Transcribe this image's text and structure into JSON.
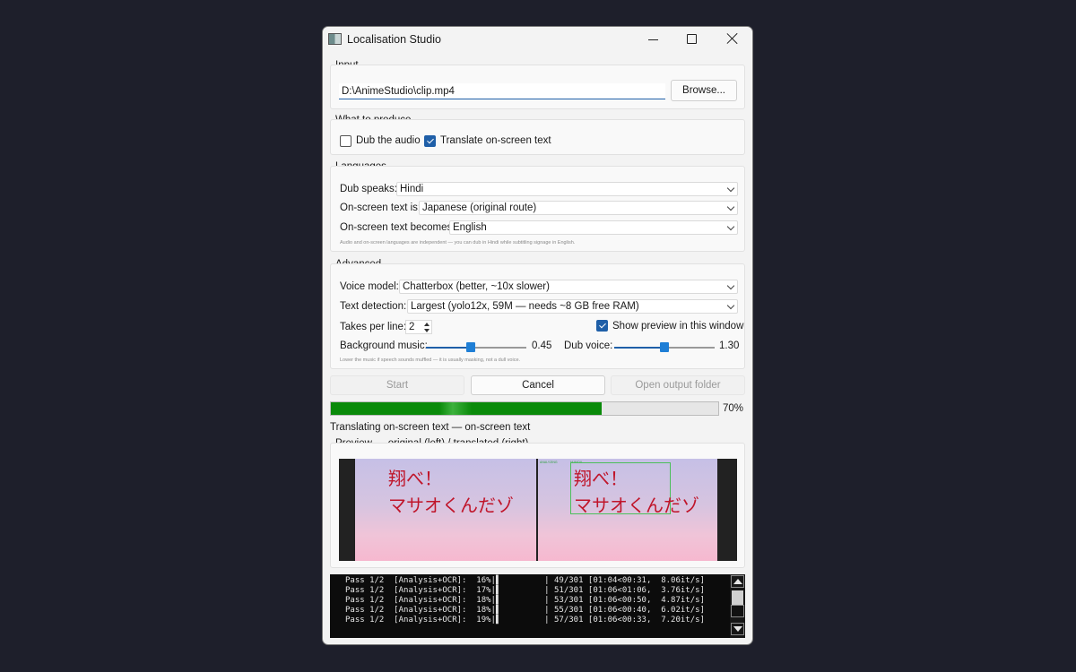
{
  "window": {
    "title": "Localisation Studio"
  },
  "input": {
    "group_title": "Input",
    "path_value": "D:\\AnimeStudio\\clip.mp4",
    "browse_label": "Browse..."
  },
  "produce": {
    "group_title": "What to produce",
    "dub_label": "Dub the audio",
    "dub_checked": false,
    "translate_label": "Translate on-screen text",
    "translate_checked": true
  },
  "languages": {
    "group_title": "Languages",
    "dub_speaks_label": "Dub speaks:",
    "dub_speaks_value": "Hindi",
    "onscreen_is_label": "On-screen text is:",
    "onscreen_is_value": "Japanese (original route)",
    "onscreen_becomes_label": "On-screen text becomes:",
    "onscreen_becomes_value": "English",
    "hint": "Audio and on-screen languages are independent — you can dub in Hindi while subtitling signage in English."
  },
  "advanced": {
    "group_title": "Advanced",
    "voice_model_label": "Voice model:",
    "voice_model_value": "Chatterbox (better, ~10x slower)",
    "text_detection_label": "Text detection:",
    "text_detection_value": "Largest (yolo12x, 59M — needs ~8 GB free RAM)",
    "takes_label": "Takes per line:",
    "takes_value": "2",
    "show_preview_label": "Show preview in this window",
    "show_preview_checked": true,
    "bg_music_label": "Background music:",
    "bg_music_value": "0.45",
    "bg_music_fraction": 0.45,
    "dub_voice_label": "Dub voice:",
    "dub_voice_value": "1.30",
    "dub_voice_fraction": 0.5,
    "hint": "Lower the music if speech sounds muffled — it is usually masking, not a dull voice."
  },
  "actions": {
    "start_label": "Start",
    "cancel_label": "Cancel",
    "open_output_label": "Open output folder"
  },
  "progress": {
    "percent": 70,
    "percent_label": "70%",
    "status": "Translating on-screen text — on-screen text"
  },
  "preview": {
    "group_title": "Preview — original (left) / translated (right)",
    "line1": "翔べ！",
    "line2": "マサオくんだゾ",
    "det_label_a": "ANALYZING",
    "det_label_b": "NUMOU"
  },
  "console": {
    "lines": [
      "Pass 1/2  [Analysis+OCR]:  16%|▌         | 49/301 [01:04<00:31,  8.06it/s]",
      "Pass 1/2  [Analysis+OCR]:  17%|▌         | 51/301 [01:06<01:06,  3.76it/s]",
      "Pass 1/2  [Analysis+OCR]:  18%|▌         | 53/301 [01:06<00:50,  4.87it/s]",
      "Pass 1/2  [Analysis+OCR]:  18%|▌         | 55/301 [01:06<00:40,  6.02it/s]",
      "Pass 1/2  [Analysis+OCR]:  19%|▌         | 57/301 [01:06<00:33,  7.20it/s]"
    ]
  },
  "colors": {
    "accent": "#1f5fa8",
    "progress_green": "#0a8a0a",
    "desktop_bg": "#1e1f2b",
    "jp_text_red": "#c0152a"
  },
  "icons": [
    "app-icon",
    "minimize-icon",
    "maximize-icon",
    "close-icon",
    "chevron-down-icon",
    "checkmark-icon",
    "spin-up-icon",
    "spin-down-icon",
    "scroll-up-icon",
    "scroll-down-icon"
  ]
}
